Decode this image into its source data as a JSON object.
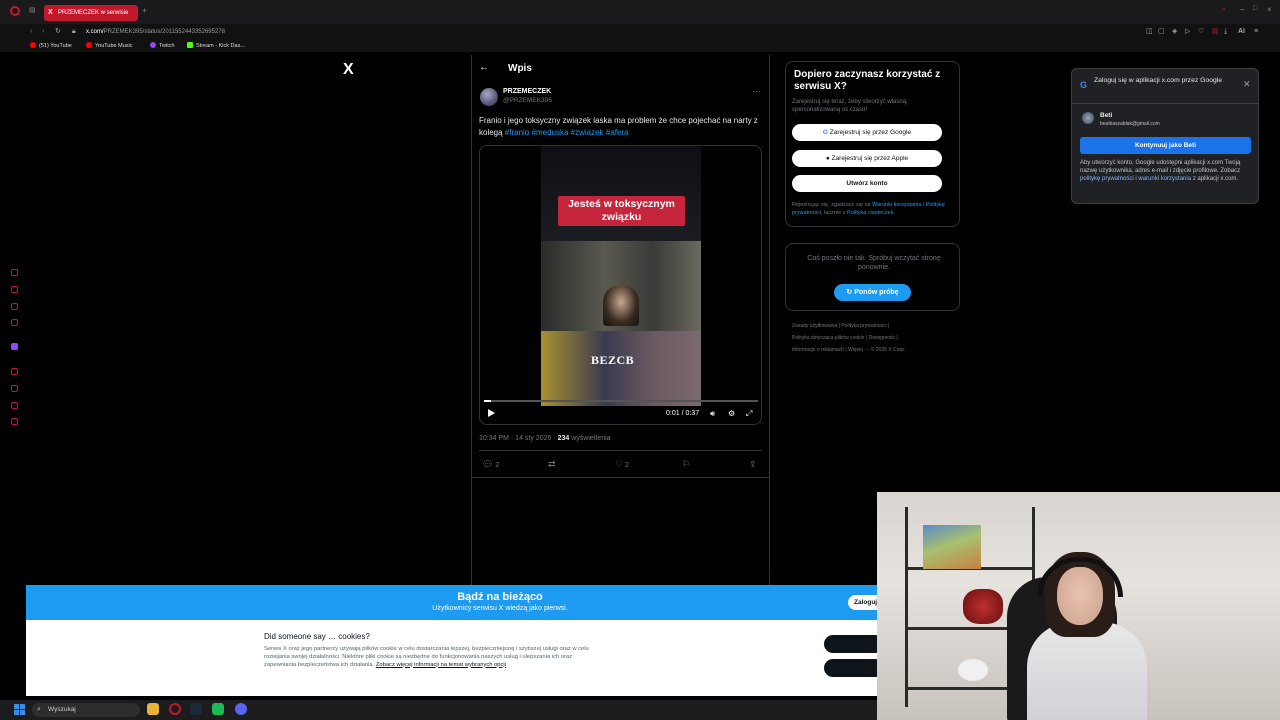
{
  "browser": {
    "tab_title": "PRZEMECZEK w serwisie",
    "url_prefix": "x.com/",
    "url_rest": "PRZEMEK395/status/2011552443352695278"
  },
  "bookmarks": [
    {
      "label": "(51) YouTube",
      "color": "#ff0000"
    },
    {
      "label": "YouTube Music",
      "color": "#ff0000"
    },
    {
      "label": "Twitch",
      "color": "#9146ff"
    },
    {
      "label": "Stream - Kick Das...",
      "color": "#53fc18"
    }
  ],
  "x": {
    "logo": "X",
    "header_title": "Wpis",
    "back_icon": "arrow-left-icon"
  },
  "tweet": {
    "author_name": "PRZEMECZEK",
    "author_handle": "@PRZEMEK395",
    "text": "Franio i jego toksyczny związek laska ma problem że chce pojechać na narty z kolegą ",
    "hashtags": [
      "#franio",
      "#meduska",
      "#zwiazek",
      "#afera"
    ],
    "video": {
      "caption": "Jesteś w toksycznym związku",
      "brand": "BEZCB",
      "time": "0:01 / 0:37",
      "progress": 0.027
    },
    "date": "10:34 PM · 14 sty 2026 · ",
    "views_count": "234",
    "views_label": " wyświetlenia",
    "replies": "2",
    "likes": "2"
  },
  "signup": {
    "title": "Dopiero zaczynasz korzystać z serwisu X?",
    "subtitle": "Zarejestruj się teraz, żeby stworzyć własną, spersonalizowaną oś czasu!",
    "google_btn": "Zarejestruj się przez Google",
    "apple_btn": "Zarejestruj się przez Apple",
    "create_btn": "Utwórz konto",
    "legal_1": "Rejestrując się, zgadzasz się na ",
    "legal_terms": "Warunki korzystania",
    "legal_2": " i ",
    "legal_privacy": "Politykę prywatności",
    "legal_3": ", łącznie z ",
    "legal_cookies": "Polityką ciasteczek",
    "legal_4": "."
  },
  "trend": {
    "error": "Coś poszło nie tak. Spróbuj wczytać stronę ponownie.",
    "retry": "Ponów próbę"
  },
  "footer": {
    "line1": "Zasady użytkowania  |  Polityka prywatności  |",
    "line2": "Polityka dotycząca plików cookie  |  Dostępność  |",
    "line3": "Informacje o reklamach  |  Więcej ···  © 2026 X Corp."
  },
  "google_popup": {
    "title": "Zaloguj się w aplikacji x.com przez Google",
    "account_name": "Beti",
    "account_email": "beatkaszablak@gmail.com",
    "continue": "Kontynuuj jako Beti",
    "desc_1": "Aby utworzyć konto, Google udostępni aplikacji x.com Twoją nazwę użytkownika, adres e-mail i zdjęcie profilowe. Zobacz ",
    "desc_policy": "politykę prywatności i warunki korzystania",
    "desc_2": " z aplikacji x.com."
  },
  "banner": {
    "title": "Bądź na bieżąco",
    "subtitle": "Użytkownicy serwisu X wiedzą jako pierwsi.",
    "login": "Zaloguj"
  },
  "cookies": {
    "title": "Did someone say … cookies?",
    "body": "Serwis X oraz jego partnerzy używają plików cookie w celu dostarczania lepszej, bezpieczniejszej i szybszej usługi oraz w celu rozwijania swojej działalności. Niektóre pliki cookie są niezbędne do funkcjonowania naszych usług i ulepszania ich oraz zapewniania bezpieczeństwa ich działania.",
    "link": "Zobacz więcej informacji na temat wybranych opcji"
  },
  "taskbar": {
    "search": "Wyszukaj"
  },
  "colors": {
    "accent": "#1d9bf0",
    "opera_red": "#c2182b",
    "google_blue": "#1a73e8"
  }
}
